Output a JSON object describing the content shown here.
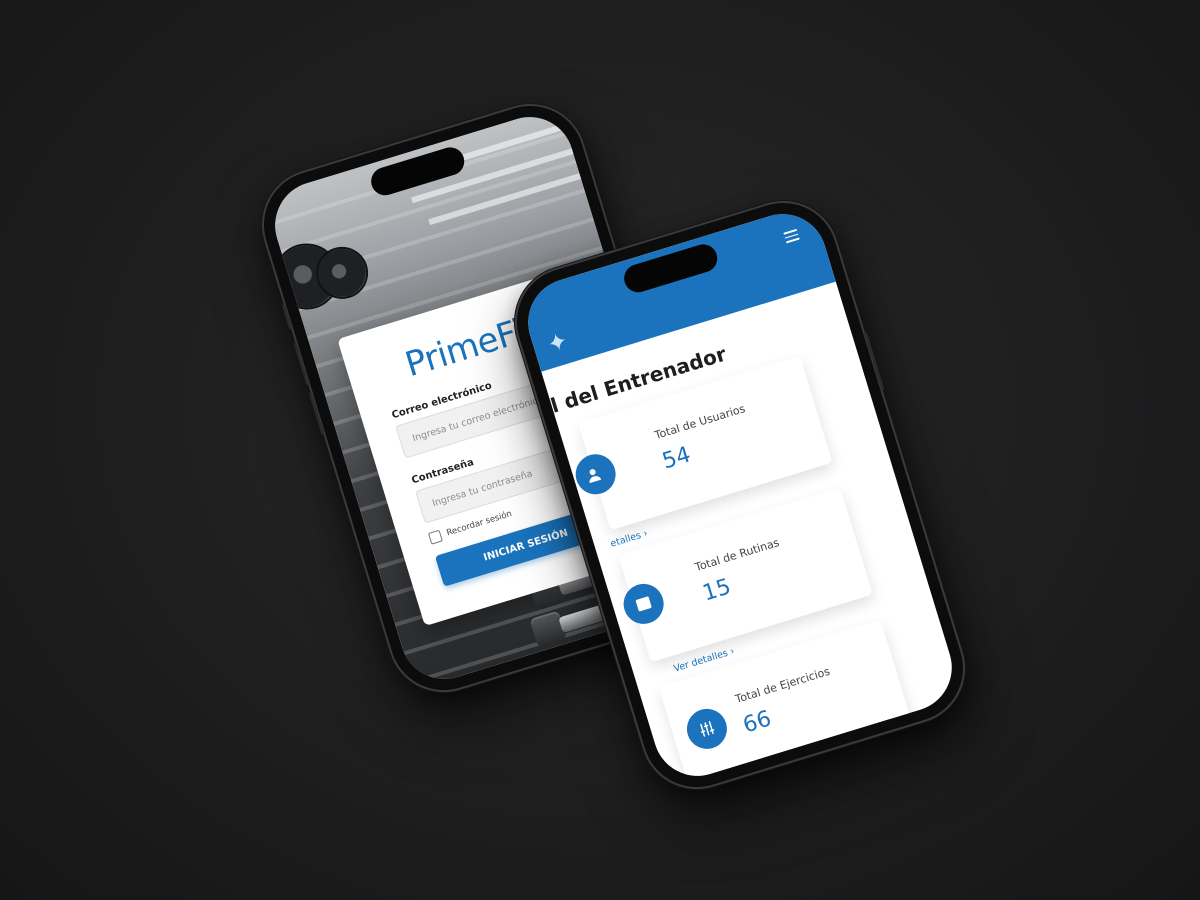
{
  "login_screen": {
    "brand": "PrimeFit",
    "email_label": "Correo electrónico",
    "email_placeholder": "Ingresa tu correo electrónico",
    "password_label": "Contraseña",
    "password_placeholder": "Ingresa tu contraseña",
    "remember_label": "Recordar sesión",
    "login_button": "INICIAR SESIÓN"
  },
  "dashboard_screen": {
    "title": "el del Entrenador",
    "menu_icon": "hamburger-menu-icon",
    "cards": [
      {
        "label": "Total de Usuarios",
        "value": "54",
        "link": "etalles  ›",
        "icon": "users-icon"
      },
      {
        "label": "Total de Rutinas",
        "value": "15",
        "link": "Ver detalles  ›",
        "icon": "routine-icon"
      },
      {
        "label": "Total de Ejercicios",
        "value": "66",
        "link": "",
        "icon": "sliders-icon"
      }
    ]
  },
  "colors": {
    "accent": "#1a73bc",
    "background": "#1d1d1e"
  }
}
